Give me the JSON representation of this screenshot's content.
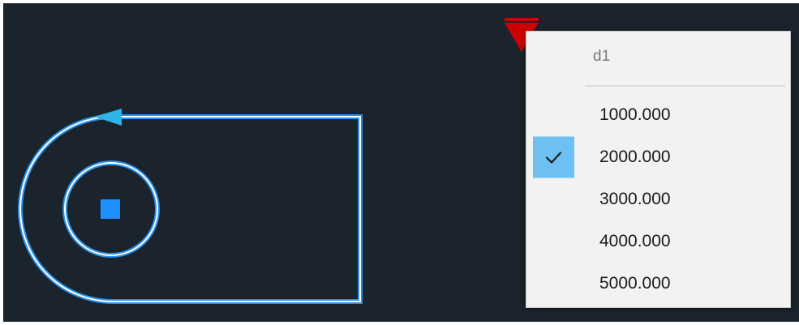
{
  "dropdown": {
    "header": "d1",
    "options": [
      "1000.000",
      "2000.000",
      "3000.000",
      "4000.000",
      "5000.000"
    ],
    "selected_index": 1
  },
  "colors": {
    "canvas_bg": "#1b232c",
    "geometry_stroke": "#ffffff",
    "geometry_highlight": "#2a8fe8",
    "grip_square": "#1e90ff",
    "direction_arrow": "#2fb4e8",
    "dimension_marker": "#cc0000",
    "check_background": "#6fc0f2"
  }
}
